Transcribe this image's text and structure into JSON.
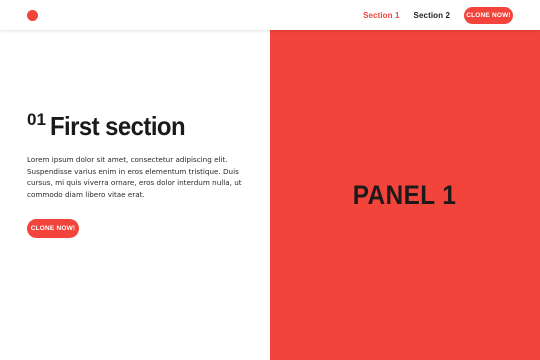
{
  "header": {
    "nav": [
      {
        "label": "Section 1",
        "active": true
      },
      {
        "label": "Section 2",
        "active": false
      }
    ],
    "cta_label": "CLONE NOW!"
  },
  "section": {
    "number": "01",
    "title": "First section",
    "body": "Lorem ipsum dolor sit amet, consectetur adipiscing elit. Suspendisse varius enim in eros elementum tristique. Duis cursus, mi quis viverra ornare, eros dolor interdum nulla, ut commodo diam libero vitae erat.",
    "cta_label": "CLONE NOW!"
  },
  "panel": {
    "title": "PANEL 1"
  },
  "colors": {
    "accent": "#f2443b",
    "text": "#1a1a1a",
    "background": "#ffffff"
  }
}
